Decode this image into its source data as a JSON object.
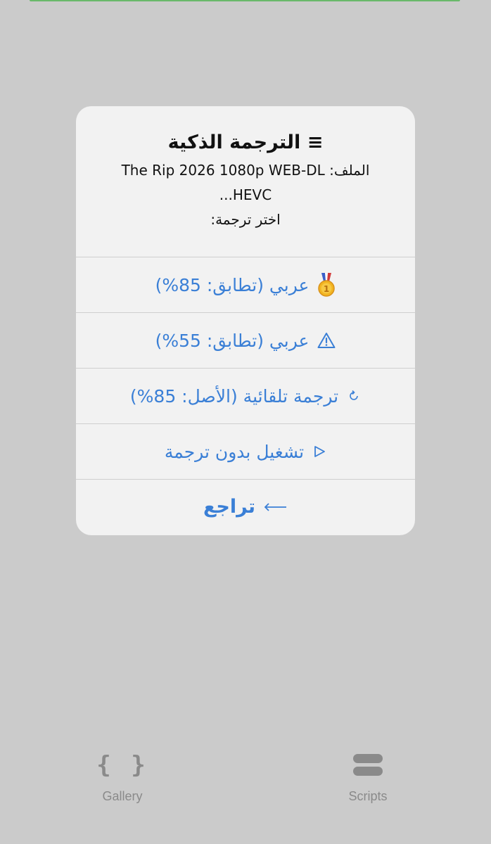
{
  "alert": {
    "title": "≡ الترجمة الذكية",
    "message_file": "الملف: The Rip 2026 1080p WEB-DL HEVC...",
    "message_prompt": "اختر ترجمة:",
    "actions": [
      {
        "icon": "medal-icon",
        "emoji": "🥇",
        "label": "عربي (تطابق: 85%)"
      },
      {
        "icon": "warning-icon",
        "emoji": "⚠",
        "label": "عربي (تطابق: 55%)"
      },
      {
        "icon": "auto-translate-icon",
        "emoji": "⟲",
        "label": "ترجمة تلقائية (الأصل: 85%)"
      },
      {
        "icon": "play-icon",
        "emoji": "▷",
        "label": "تشغيل بدون ترجمة"
      }
    ],
    "back": {
      "icon": "arrow-left-icon",
      "emoji": "⟵",
      "label": "تراجع"
    }
  },
  "tabbar": {
    "gallery": {
      "icon": "braces-icon",
      "glyph": "{ }",
      "label": "Gallery"
    },
    "scripts": {
      "icon": "stack-icon",
      "label": "Scripts"
    }
  },
  "colors": {
    "background": "#cbcbcb",
    "alert_bg": "#f2f2f2",
    "action_blue": "#3a7fd6",
    "tab_gray": "#8a8a8a",
    "indicator_green": "#69b96a"
  }
}
